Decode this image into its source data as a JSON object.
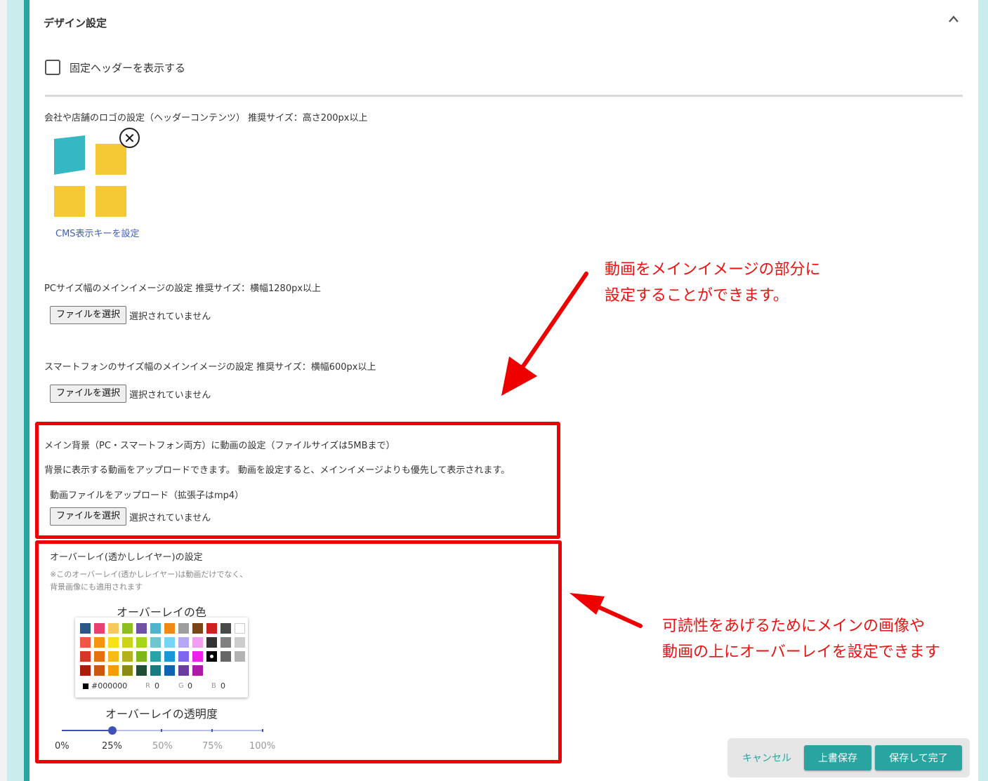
{
  "section": {
    "title": "デザイン設定",
    "fixed_header_label": "固定ヘッダーを表示する"
  },
  "logo": {
    "label": "会社や店舗のロゴの設定（ヘッダーコンテンツ） 推奨サイズ：高さ200px以上",
    "remove_icon": "close-circle-icon",
    "link": "CMS表示キーを設定",
    "colors": {
      "teal": "#35b8c2",
      "yellow": "#f4c935"
    }
  },
  "pc_image": {
    "label": "PCサイズ幅のメインイメージの設定 推奨サイズ：横幅1280px以上",
    "button": "ファイルを選択",
    "status": "選択されていません"
  },
  "sp_image": {
    "label": "スマートフォンのサイズ幅のメインイメージの設定 推奨サイズ：横幅600px以上",
    "button": "ファイルを選択",
    "status": "選択されていません"
  },
  "video": {
    "label": "メイン背景（PC・スマートフォン両方）に動画の設定（ファイルサイズは5MBまで）",
    "description": "背景に表示する動画をアップロードできます。 動画を設定すると、メインイメージよりも優先して表示されます。",
    "upload_label": "動画ファイルをアップロード（拡張子はmp4）",
    "button": "ファイルを選択",
    "status": "選択されていません"
  },
  "overlay": {
    "title": "オーバーレイ(透かしレイヤー)の設定",
    "note_line1": "※このオーバーレイ(透かしレイヤー)は動画だけでなく、",
    "note_line2": "背景画像にも適用されます",
    "color_heading": "オーバーレイの色",
    "palette": [
      [
        "#2b5686",
        "#e8406f",
        "#f7c85b",
        "#8dbf1e",
        "#6d52a6",
        "#4fb4c9",
        "#ef8b15",
        "#9e9e9e",
        "#7a4518",
        "#d01f1f",
        "#4a4a4a",
        "#ffffff"
      ],
      [
        "#f05545",
        "#f5940f",
        "#f7e11b",
        "#cbd41b",
        "#a5d51c",
        "#6ec7cf",
        "#75d5f5",
        "#b6a8f5",
        "#f49ef2",
        "#333333",
        "#808080",
        "#cccccc"
      ],
      [
        "#d93725",
        "#e2740f",
        "#f5bb16",
        "#b4b21b",
        "#7fb618",
        "#2ba3a6",
        "#1898d6",
        "#7f67ef",
        "#ee1fea",
        "#000000",
        "#666666",
        "#b3b3b3"
      ],
      [
        "#a91b0d",
        "#c9570f",
        "#f49d09",
        "#8b8b14",
        "#1e4e36",
        "#177b80",
        "#0e64b1",
        "#6a3ea0",
        "#ac1ba7"
      ]
    ],
    "selected_hex": "#000000",
    "r_label": "R",
    "r_value": "0",
    "g_label": "G",
    "g_value": "0",
    "b_label": "B",
    "b_value": "0",
    "opacity_heading": "オーバーレイの透明度",
    "opacity_value": 0.25,
    "ticks": [
      "0%",
      "25%",
      "50%",
      "75%",
      "100%"
    ]
  },
  "annotations": {
    "video_line1": "動画をメインイメージの部分に",
    "video_line2": "設定することができます。",
    "overlay_line1": "可読性をあげるためにメインの画像や",
    "overlay_line2": "動画の上にオーバーレイを設定できます",
    "color": "#ee0000"
  },
  "footer": {
    "cancel": "キャンセル",
    "overwrite": "上書保存",
    "save_complete": "保存して完了"
  }
}
